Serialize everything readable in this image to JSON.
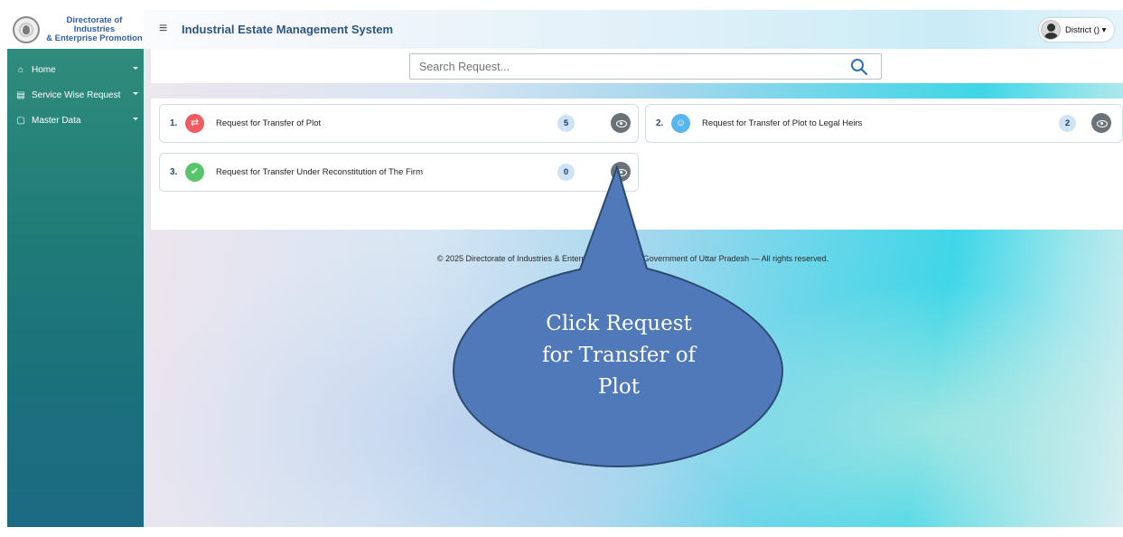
{
  "header": {
    "brand_line1": "Directorate of Industries",
    "brand_line2": "& Enterprise Promotion",
    "menu_icon": "≡",
    "app_title": "Industrial Estate Management System",
    "user_label": "District () ▾"
  },
  "sidebar": {
    "items": [
      {
        "label": "Home",
        "icon": "home-icon",
        "glyph": "⌂"
      },
      {
        "label": "Service Wise Request",
        "icon": "list-icon",
        "glyph": "▤"
      },
      {
        "label": "Master Data",
        "icon": "document-icon",
        "glyph": "▢"
      }
    ]
  },
  "search": {
    "placeholder": "Search Request..."
  },
  "requests": [
    {
      "num": "1.",
      "label": "Request for Transfer of Plot",
      "count": "5",
      "icon": "transfer-arrows-icon",
      "glyph": "⇄",
      "color": "#ef5b61"
    },
    {
      "num": "2.",
      "label": "Request for Transfer of Plot to Legal Heirs",
      "count": "2",
      "icon": "family-icon",
      "glyph": "☺",
      "color": "#58b6ef"
    },
    {
      "num": "3.",
      "label": "Request for Transfer Under Reconstitution of The Firm",
      "count": "0",
      "icon": "user-check-icon",
      "glyph": "✔",
      "color": "#57c66a"
    }
  ],
  "footer": {
    "text": "© 2025 Directorate of Industries & Enterprise Promotion, Government of Uttar Pradesh — All rights reserved."
  },
  "callout": {
    "line1": "Click Request",
    "line2": "for Transfer of",
    "line3": "Plot",
    "fill": "#4f79b8",
    "stroke": "#2d4a73"
  }
}
